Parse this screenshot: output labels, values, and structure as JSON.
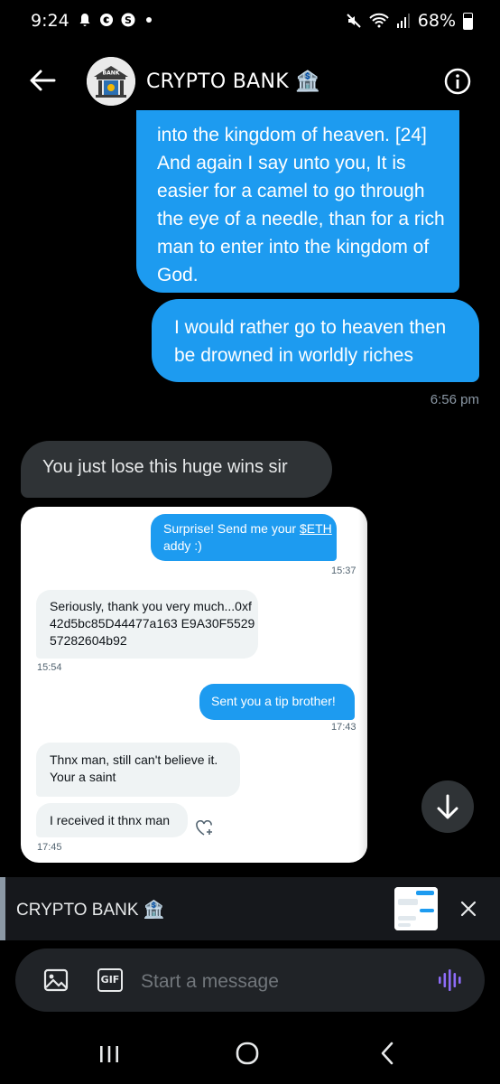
{
  "status_bar": {
    "time": "9:24",
    "battery": "68%",
    "icons": [
      "notification-bell-icon",
      "c-app-icon",
      "dollar-app-icon",
      "dot-icon",
      "mute-icon",
      "wifi-calling-icon",
      "signal-icon",
      "battery-icon"
    ]
  },
  "header": {
    "title": "CRYPTO BANK 🏦",
    "avatar_text": "BANK",
    "back_icon": "back-arrow-icon",
    "info_icon": "info-icon"
  },
  "messages": [
    {
      "direction": "outgoing",
      "text": "into the kingdom of heaven. [24] And again I say unto you, It is easier for a camel to go through the eye of a needle, than for a rich man to enter into the kingdom of God."
    },
    {
      "direction": "outgoing",
      "text": "I would rather go to heaven then be drowned in worldly riches"
    },
    {
      "timestamp": "6:56 pm"
    },
    {
      "direction": "incoming",
      "text": "You just lose this huge wins sir"
    }
  ],
  "image_message": {
    "bubbles": [
      {
        "side": "right",
        "text_a": "Surprise! Send me your ",
        "link": "$ETH",
        "text_b": "addy :)",
        "time": "15:37"
      },
      {
        "side": "left",
        "text": "Seriously, thank you very much...0xf42d5bc85D44477a163 E9A30F552957282604b92",
        "time": "15:54"
      },
      {
        "side": "right",
        "text": "Sent you a tip brother!",
        "time": "17:43"
      },
      {
        "side": "left",
        "text": "Thnx man, still can't believe it. Your a saint"
      },
      {
        "side": "left",
        "text": "I received it thnx man",
        "time": "17:45"
      }
    ]
  },
  "reply_preview": {
    "title": "CRYPTO BANK 🏦"
  },
  "composer": {
    "placeholder": "Start a message",
    "gif_label": "GIF"
  },
  "colors": {
    "accent": "#1d9bf0",
    "background": "#000000",
    "incoming_bubble": "#2f3336",
    "voice_icon": "#8d6cf7"
  }
}
